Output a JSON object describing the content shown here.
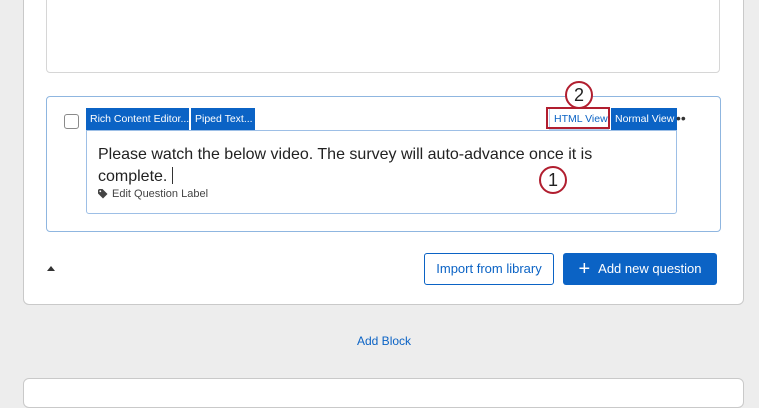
{
  "question": {
    "toolbar": {
      "rich_content_editor": "Rich Content Editor...",
      "piped_text": "Piped Text...",
      "html_view": "HTML View",
      "normal_view": "Normal View",
      "more": "••"
    },
    "text": "Please watch the below video. The survey will auto-advance once it is complete.",
    "edit_label": "Edit Question Label"
  },
  "annotations": {
    "callout_1": "1",
    "callout_2": "2",
    "callout_color": "#b11e2f"
  },
  "actions": {
    "import_from_library": "Import from library",
    "add_new_question_icon": "+",
    "add_new_question": "Add new question"
  },
  "add_block": "Add Block",
  "colors": {
    "accent": "#0b63c5",
    "background": "#ededed"
  }
}
